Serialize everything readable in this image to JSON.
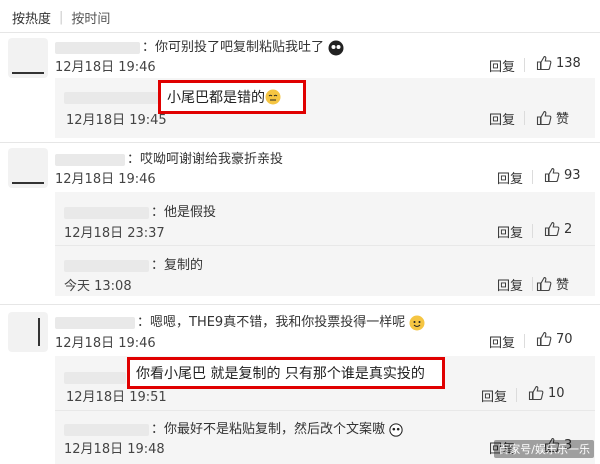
{
  "sort": {
    "hot": "按热度",
    "sep": "|",
    "time": "按时间"
  },
  "comments": [
    {
      "text": "：你可别投了吧复制粘贴我吐了",
      "time": "12月18日 19:46",
      "reply": "回复",
      "likes": "138"
    },
    {
      "text": "小尾巴都是错的",
      "time": "12月18日 19:45",
      "reply": "回复",
      "likes": "赞"
    },
    {
      "text": "：哎呦呵谢谢给我豪折亲投",
      "time": "12月18日 19:46",
      "reply": "回复",
      "likes": "93"
    },
    {
      "text": "：他是假投",
      "time": "12月18日 23:37",
      "reply": "回复",
      "likes": "2"
    },
    {
      "text": "：复制的",
      "time": "今天 13:08",
      "reply": "回复",
      "likes": "赞"
    },
    {
      "text": "：嗯嗯，THE9真不错，我和你投票投得一样呢",
      "time": "12月18日 19:46",
      "reply": "回复",
      "likes": "70"
    },
    {
      "text": "你看小尾巴  就是复制的  只有那个谁是真实投的",
      "time": "12月18日 19:51",
      "reply": "回复",
      "likes": "10"
    },
    {
      "text": "：你最好不是粘贴复制，然后改个文案嗷",
      "time": "12月18日 19:48",
      "reply": "回复",
      "likes": "3"
    }
  ],
  "watermark": "百家号/娱乐乐一乐",
  "colors": {
    "highlight": "#e00000",
    "subbg": "#f5f5f5"
  }
}
